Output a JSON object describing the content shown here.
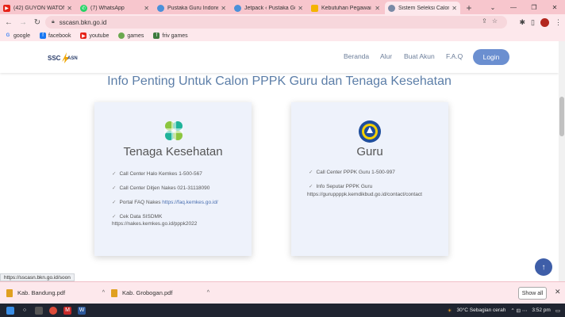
{
  "browser": {
    "tabs": [
      {
        "label": "(42) GUYON WATON",
        "icon": "youtube-icon",
        "color": "#e62117"
      },
      {
        "label": "(7) WhatsApp",
        "icon": "whatsapp-icon",
        "color": "#25d366"
      },
      {
        "label": "Pustaka Guru Indonesia",
        "icon": "globe-icon",
        "color": "#4a90d9"
      },
      {
        "label": "Jetpack ‹ Pustaka Guru",
        "icon": "globe-icon",
        "color": "#4a90d9"
      },
      {
        "label": "Kebutuhan Pegawai ASN",
        "icon": "drive-icon",
        "color": "#f4b400"
      },
      {
        "label": "Sistem Seleksi Calon ASN",
        "icon": "globe-icon",
        "color": "#7a8aa6"
      }
    ],
    "new_tab_label": "+",
    "url": "sscasn.bkn.go.id",
    "bookmarks": [
      {
        "label": "google",
        "icon": "google-icon",
        "color": "#4285f4"
      },
      {
        "label": "facebook",
        "icon": "facebook-icon",
        "color": "#1877f2"
      },
      {
        "label": "youtube",
        "icon": "youtube-icon",
        "color": "#e62117"
      },
      {
        "label": "games",
        "icon": "games-icon",
        "color": "#6aa84f"
      },
      {
        "label": "friv games",
        "icon": "friv-icon",
        "color": "#3d7a3d"
      }
    ]
  },
  "site": {
    "nav": [
      "Beranda",
      "Alur",
      "Buat Akun",
      "F.A.Q"
    ],
    "login_label": "Login",
    "headline": "Info Penting Untuk Calon PPPK Guru dan Tenaga Kesehatan",
    "kes_card": {
      "title": "Tenaga Kesehatan",
      "items": [
        {
          "text": "Call Center Halo Kemkes 1-500-567"
        },
        {
          "text": "Call Center Ditjen Nakes 021-31118090"
        },
        {
          "text": "Portal FAQ Nakes ",
          "link": "https://faq.kemkes.go.id/"
        },
        {
          "text": "Cek Data SISDMK",
          "link": "https://nakes.kemkes.go.id/pppk2022"
        }
      ]
    },
    "guru_card": {
      "title": "Guru",
      "items": [
        {
          "text": "Call Center PPPK Guru 1-500-997"
        },
        {
          "text": "Info Seputar PPPK Guru",
          "link": "https://guruppppk.kemdikbud.go.id/contact/contact"
        }
      ]
    },
    "status_url": "https://sscasn.bkn.go.id/soon"
  },
  "downloads": {
    "files": [
      "Kab. Bandung.pdf",
      "Kab. Grobogan.pdf"
    ],
    "show_all_label": "Show all"
  },
  "taskbar": {
    "weather": "30°C  Sebagian cerah",
    "time": "3:52 pm"
  }
}
